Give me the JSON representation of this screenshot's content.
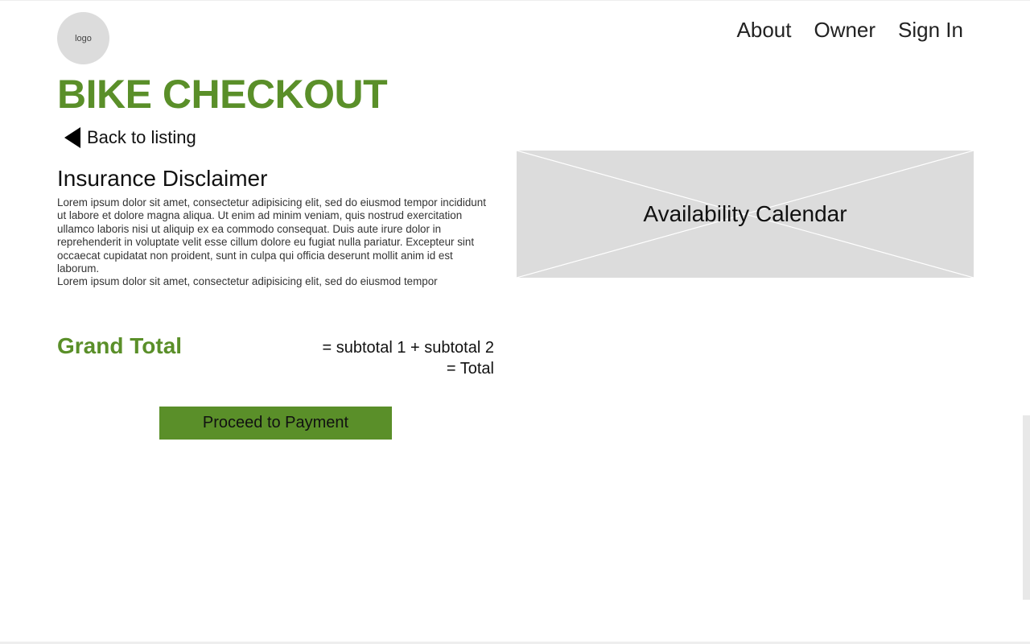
{
  "header": {
    "logo_text": "logo",
    "nav": {
      "about": "About",
      "owner": "Owner",
      "sign_in": "Sign In"
    }
  },
  "main": {
    "title": "BIKE CHECKOUT",
    "back_link": "Back to listing",
    "disclaimer": {
      "heading": "Insurance Disclaimer",
      "paragraph_1": "Lorem ipsum dolor sit amet, consectetur adipisicing elit, sed do eiusmod tempor incididunt ut labore et dolore magna aliqua. Ut enim ad minim veniam, quis nostrud exercitation ullamco laboris nisi ut aliquip ex ea commodo consequat. Duis aute irure dolor in reprehenderit in voluptate velit esse cillum dolore eu fugiat nulla pariatur. Excepteur sint occaecat cupidatat non proident, sunt in culpa qui officia deserunt mollit anim id est laborum.",
      "paragraph_2": "Lorem ipsum dolor sit amet, consectetur adipisicing elit, sed do eiusmod tempor"
    },
    "calendar_placeholder": "Availability Calendar",
    "grand_total": {
      "label": "Grand Total",
      "formula_line_1": "= subtotal 1 + subtotal 2",
      "formula_line_2": "= Total"
    },
    "proceed_button": "Proceed to Payment"
  },
  "colors": {
    "accent_green": "#5a8f29",
    "placeholder_gray": "#dcdcdc"
  }
}
